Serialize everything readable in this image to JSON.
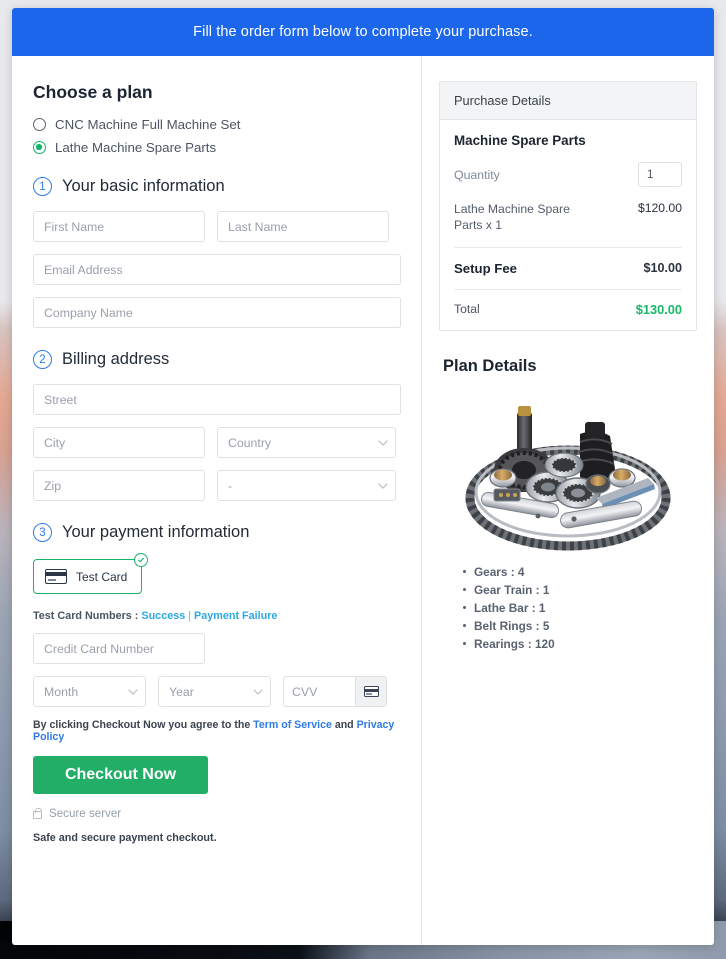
{
  "banner": {
    "message": "Fill the order form below to complete your purchase."
  },
  "plan_chooser": {
    "title": "Choose a plan",
    "options": [
      {
        "label": "CNC Machine Full Machine Set",
        "selected": false
      },
      {
        "label": "Lathe Machine Spare Parts",
        "selected": true
      }
    ]
  },
  "steps": {
    "basic": {
      "number": "1",
      "title": "Your basic information"
    },
    "billing": {
      "number": "2",
      "title": "Billing address"
    },
    "payment": {
      "number": "3",
      "title": "Your payment information"
    }
  },
  "basic_fields": {
    "first_name": {
      "placeholder": "First Name",
      "value": ""
    },
    "last_name": {
      "placeholder": "Last Name",
      "value": ""
    },
    "email": {
      "placeholder": "Email Address",
      "value": ""
    },
    "company": {
      "placeholder": "Company Name",
      "value": ""
    }
  },
  "billing_fields": {
    "street": {
      "placeholder": "Street",
      "value": ""
    },
    "city": {
      "placeholder": "City",
      "value": ""
    },
    "country": {
      "selected": "Country"
    },
    "zip": {
      "placeholder": "Zip",
      "value": ""
    },
    "state": {
      "selected": "-"
    }
  },
  "payment": {
    "method_label": "Test Card",
    "test_numbers_prefix": "Test Card Numbers : ",
    "test_success_link": "Success",
    "test_separator": " | ",
    "test_failure_link": "Payment Failure",
    "card_number": {
      "placeholder": "Credit Card Number",
      "value": ""
    },
    "month": {
      "selected": "Month"
    },
    "year": {
      "selected": "Year"
    },
    "cvv": {
      "placeholder": "CVV",
      "value": ""
    }
  },
  "legal": {
    "agree_prefix": "By clicking Checkout Now you agree to the ",
    "terms_link": "Term of Service",
    "agree_joiner": " and ",
    "privacy_link": "Privacy Policy",
    "checkout_button": "Checkout Now",
    "secure_server": "Secure server",
    "safe_note": "Safe and secure payment checkout."
  },
  "purchase": {
    "header": "Purchase Details",
    "product_name": "Machine Spare Parts",
    "quantity_label": "Quantity",
    "quantity_value": "1",
    "line_item_name": "Lathe Machine Spare Parts x 1",
    "line_item_amount": "$120.00",
    "setup_fee_label": "Setup Fee",
    "setup_fee_amount": "$10.00",
    "total_label": "Total",
    "total_amount": "$130.00",
    "total_color": "#14b866"
  },
  "plan_details": {
    "title": "Plan Details",
    "image_alt": "machine-spare-parts-photo",
    "features": [
      "Gears : 4",
      "Gear Train : 1",
      "Lathe Bar : 1",
      "Belt Rings : 5",
      "Rearings : 120"
    ]
  },
  "theme": {
    "banner_blue": "#1b66ea",
    "accent_green": "#22ae67",
    "link_blue": "#2f7ae5",
    "step_blue": "#2f7ae5"
  }
}
